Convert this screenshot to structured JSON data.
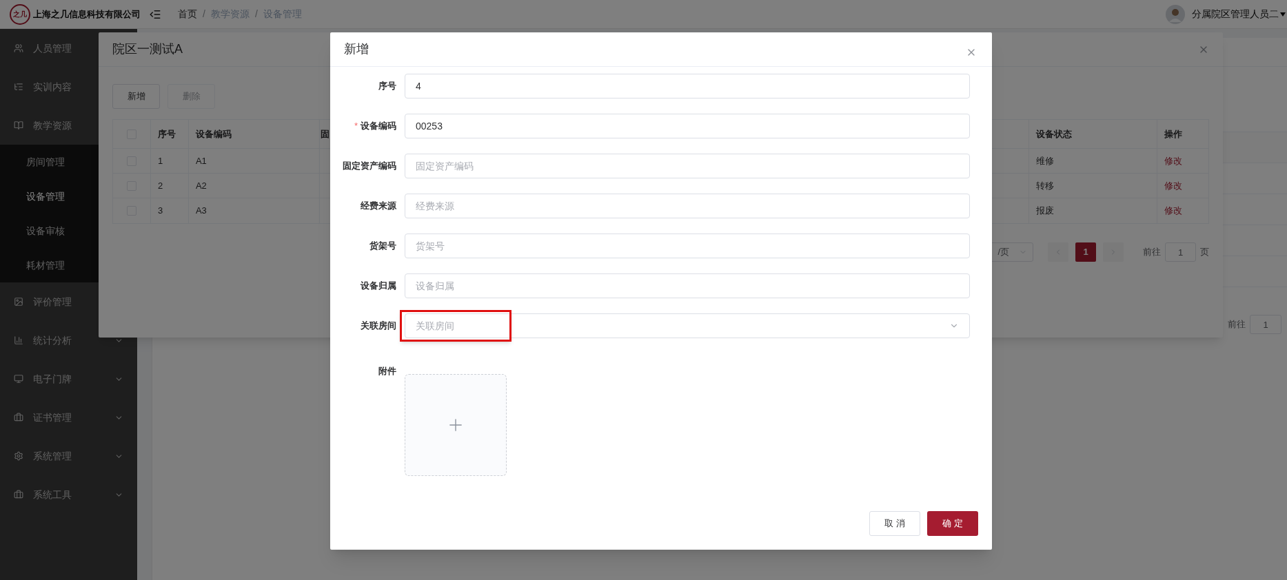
{
  "header": {
    "logo_text": "之几",
    "company": "上海之几信息科技有限公司",
    "breadcrumbs": [
      {
        "label": "首页",
        "link": true
      },
      {
        "label": "教学资源",
        "link": false
      },
      {
        "label": "设备管理",
        "link": false
      }
    ],
    "separator": "/",
    "user": "分属院区管理人员二"
  },
  "sidebar": {
    "items": [
      {
        "label": "人员管理",
        "kind": "link"
      },
      {
        "label": "实训内容",
        "kind": "link"
      },
      {
        "label": "教学资源",
        "kind": "group",
        "expanded": true,
        "children": [
          {
            "label": "房间管理",
            "selected": false
          },
          {
            "label": "设备管理",
            "selected": true
          },
          {
            "label": "设备审核",
            "selected": false
          },
          {
            "label": "耗材管理",
            "selected": false
          }
        ]
      },
      {
        "label": "评价管理",
        "kind": "link"
      },
      {
        "label": "统计分析",
        "kind": "group",
        "expanded": false
      },
      {
        "label": "电子门牌",
        "kind": "group",
        "expanded": false
      },
      {
        "label": "证书管理",
        "kind": "group",
        "expanded": false
      },
      {
        "label": "系统管理",
        "kind": "group",
        "expanded": false
      },
      {
        "label": "系统工具",
        "kind": "group",
        "expanded": false
      }
    ]
  },
  "background_page": {
    "goto_label": "前往",
    "goto_value": "1"
  },
  "room_dialog": {
    "title": "院区一测试A",
    "buttons": [
      {
        "label": "新增",
        "disabled": false
      },
      {
        "label": "删除",
        "disabled": true
      }
    ],
    "table": {
      "header_checked": false,
      "columns": [
        "序号",
        "设备编码",
        "固",
        "设备状态",
        "操作"
      ],
      "rows": [
        {
          "selected": false,
          "cells": [
            "1",
            "A1",
            "",
            "维修",
            "修改"
          ]
        },
        {
          "selected": false,
          "cells": [
            "2",
            "A2",
            "",
            "转移",
            "修改"
          ]
        },
        {
          "selected": false,
          "cells": [
            "3",
            "A3",
            "",
            "报废",
            "修改"
          ]
        }
      ]
    },
    "pagination": {
      "page_size": "/页",
      "pages": [
        {
          "label": "1",
          "selected": true
        }
      ],
      "goto_label": "前往",
      "goto_value": "1",
      "page_suffix": "页"
    }
  },
  "add_dialog": {
    "title": "新增",
    "fields": [
      {
        "label": "序号",
        "kind": "input",
        "required": false,
        "value": "4",
        "highlight": false
      },
      {
        "label": "设备编码",
        "kind": "input",
        "required": true,
        "value": "00253",
        "highlight": false
      },
      {
        "label": "固定资产编码",
        "kind": "input",
        "required": false,
        "placeholder": "固定资产编码",
        "highlight": false
      },
      {
        "label": "经费来源",
        "kind": "input",
        "required": false,
        "placeholder": "经费来源",
        "highlight": false
      },
      {
        "label": "货架号",
        "kind": "input",
        "required": false,
        "placeholder": "货架号",
        "highlight": false
      },
      {
        "label": "设备归属",
        "kind": "input",
        "required": false,
        "placeholder": "设备归属",
        "highlight": false
      },
      {
        "label": "关联房间",
        "kind": "select",
        "required": false,
        "placeholder": "关联房间",
        "highlight": true
      }
    ],
    "required_mark": "*",
    "attachment_label": "附件",
    "buttons": [
      {
        "label": "取消",
        "kind": "default"
      },
      {
        "label": "确定",
        "kind": "primary"
      }
    ]
  }
}
